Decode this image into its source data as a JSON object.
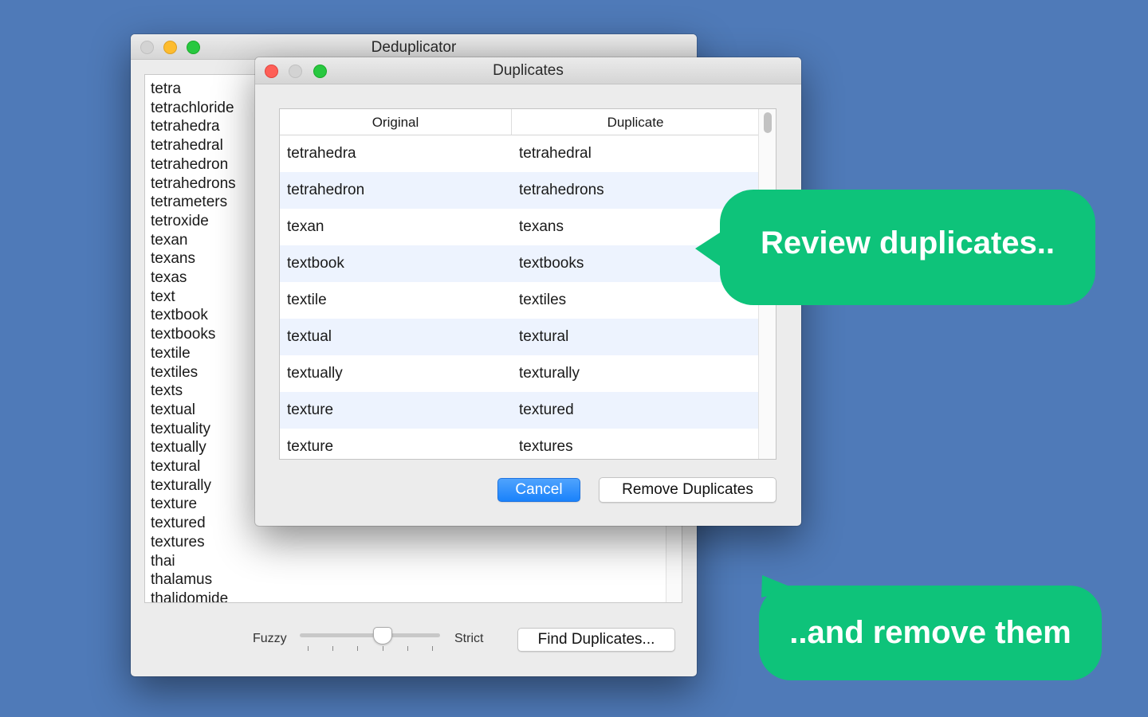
{
  "main_window": {
    "title": "Deduplicator",
    "words": [
      "tetra",
      "tetrachloride",
      "tetrahedra",
      "tetrahedral",
      "tetrahedron",
      "tetrahedrons",
      "tetrameters",
      "tetroxide",
      "texan",
      "texans",
      "texas",
      "text",
      "textbook",
      "textbooks",
      "textile",
      "textiles",
      "texts",
      "textual",
      "textuality",
      "textually",
      "textural",
      "texturally",
      "texture",
      "textured",
      "textures",
      "thai",
      "thalamus",
      "thalidomide"
    ],
    "slider": {
      "min_label": "Fuzzy",
      "max_label": "Strict",
      "value": 0.6,
      "ticks": 6
    },
    "find_button": "Find Duplicates..."
  },
  "dialog": {
    "title": "Duplicates",
    "columns": [
      "Original",
      "Duplicate"
    ],
    "rows": [
      [
        "tetrahedra",
        "tetrahedral"
      ],
      [
        "tetrahedron",
        "tetrahedrons"
      ],
      [
        "texan",
        "texans"
      ],
      [
        "textbook",
        "textbooks"
      ],
      [
        "textile",
        "textiles"
      ],
      [
        "textual",
        "textural"
      ],
      [
        "textually",
        "texturally"
      ],
      [
        "texture",
        "textured"
      ],
      [
        "texture",
        "textures"
      ]
    ],
    "cancel_button": "Cancel",
    "remove_button": "Remove Duplicates"
  },
  "callouts": {
    "review": "Review duplicates..",
    "remove": "..and remove them"
  },
  "colors": {
    "background": "#4f7ab8",
    "callout": "#0ec37a",
    "accent": "#1a82fb"
  }
}
